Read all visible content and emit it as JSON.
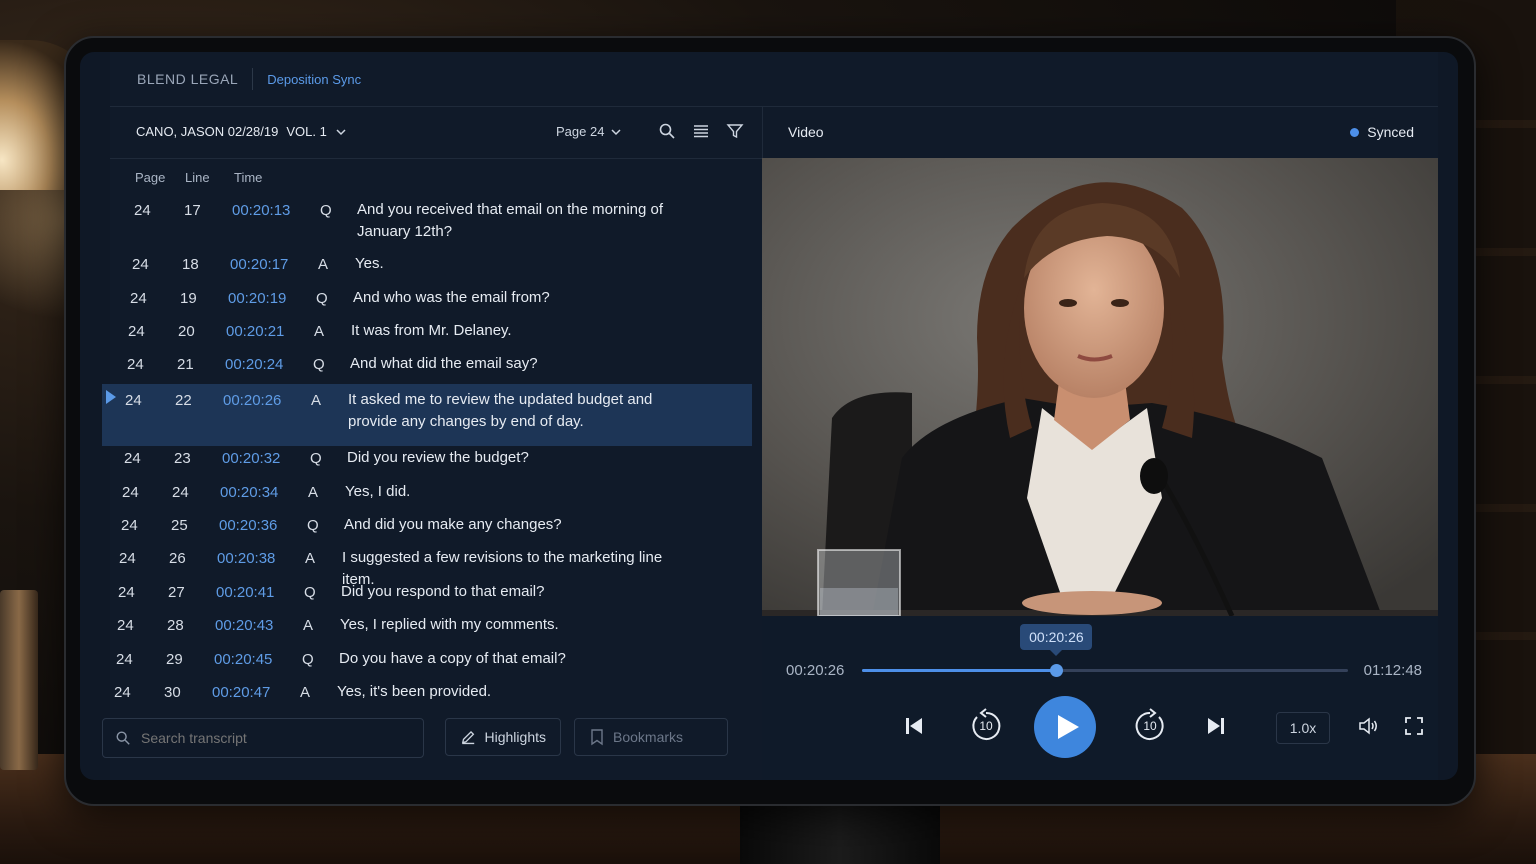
{
  "app": {
    "brand": "BLEND LEGAL",
    "module": "Deposition Sync"
  },
  "transcript": {
    "case_label": "CANO, JASON 02/28/19",
    "volume": "VOL. 1",
    "page_selector": "Page 24",
    "columns": {
      "page": "Page",
      "line": "Line",
      "time": "Time"
    },
    "rows": [
      {
        "page": "24",
        "line": "17",
        "time": "00:20:13",
        "qa": "Q",
        "text": "And you received that email on the morning of January 12th?"
      },
      {
        "page": "24",
        "line": "18",
        "time": "00:20:17",
        "qa": "A",
        "text": "Yes."
      },
      {
        "page": "24",
        "line": "19",
        "time": "00:20:19",
        "qa": "Q",
        "text": "And who was the email from?"
      },
      {
        "page": "24",
        "line": "20",
        "time": "00:20:21",
        "qa": "A",
        "text": "It was from Mr. Delaney."
      },
      {
        "page": "24",
        "line": "21",
        "time": "00:20:24",
        "qa": "Q",
        "text": "And what did the email say?"
      },
      {
        "page": "24",
        "line": "22",
        "time": "00:20:26",
        "qa": "A",
        "text": "It asked me to review the updated budget and provide any changes by end of day.",
        "active": true
      },
      {
        "page": "24",
        "line": "23",
        "time": "00:20:32",
        "qa": "Q",
        "text": "Did you review the budget?"
      },
      {
        "page": "24",
        "line": "24",
        "time": "00:20:34",
        "qa": "A",
        "text": "Yes, I did."
      },
      {
        "page": "24",
        "line": "25",
        "time": "00:20:36",
        "qa": "Q",
        "text": "And did you make any changes?"
      },
      {
        "page": "24",
        "line": "26",
        "time": "00:20:38",
        "qa": "A",
        "text": "I suggested a few revisions to the marketing line item."
      },
      {
        "page": "24",
        "line": "27",
        "time": "00:20:41",
        "qa": "Q",
        "text": "Did you respond to that email?"
      },
      {
        "page": "24",
        "line": "28",
        "time": "00:20:43",
        "qa": "A",
        "text": "Yes, I replied with my comments."
      },
      {
        "page": "24",
        "line": "29",
        "time": "00:20:45",
        "qa": "Q",
        "text": "Do you have a copy of that email?"
      },
      {
        "page": "24",
        "line": "30",
        "time": "00:20:47",
        "qa": "A",
        "text": "Yes, it's been provided."
      }
    ],
    "search_placeholder": "Search transcript",
    "highlights_label": "Highlights",
    "bookmarks_label": "Bookmarks"
  },
  "video": {
    "title": "Video",
    "sync_status": "Synced",
    "current_time": "00:20:26",
    "total_time": "01:12:48",
    "tooltip_time": "00:20:26",
    "progress_fraction": 0.4,
    "skip_seconds": "10",
    "speed": "1.0x"
  },
  "colors": {
    "accent": "#4d8fe8",
    "timestamp": "#5f9ce6",
    "active_row": "#1d3556",
    "panel": "#101a29"
  }
}
